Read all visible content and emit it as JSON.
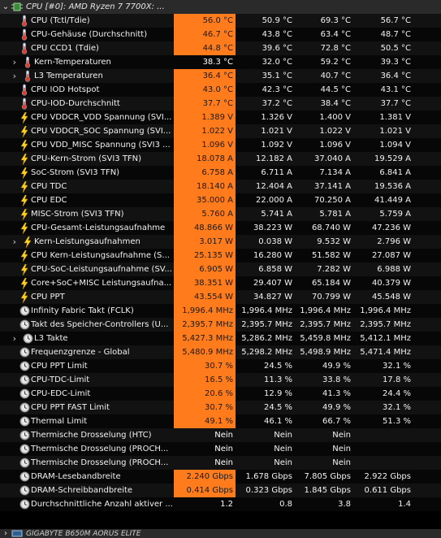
{
  "section": {
    "title": "CPU [#0]: AMD Ryzen 7 7700X: ..."
  },
  "footer_section": {
    "title": "GIGABYTE B650M AORUS ELITE"
  },
  "colors": {
    "highlight": "#ff7b1c",
    "row_odd": "#121212",
    "row_even": "#070707",
    "header": "#2a2a2a"
  },
  "rows": [
    {
      "label": "CPU (Tctl/Tdie)",
      "icon": "thermometer-icon",
      "chev": false,
      "indent": 0,
      "cur": "56.0 °C",
      "hl": true,
      "min": "50.9 °C",
      "max": "69.3 °C",
      "avg": "56.7 °C"
    },
    {
      "label": "CPU-Gehäuse (Durchschnitt)",
      "icon": "thermometer-icon",
      "chev": false,
      "indent": 0,
      "cur": "46.7 °C",
      "hl": true,
      "min": "43.8 °C",
      "max": "63.4 °C",
      "avg": "48.7 °C"
    },
    {
      "label": "CPU CCD1 (Tdie)",
      "icon": "thermometer-icon",
      "chev": false,
      "indent": 0,
      "cur": "44.8 °C",
      "hl": true,
      "min": "39.6 °C",
      "max": "72.8 °C",
      "avg": "50.5 °C"
    },
    {
      "label": "Kern-Temperaturen",
      "icon": "thermometer-icon",
      "chev": true,
      "indent": 1,
      "cur": "38.3 °C",
      "hl": false,
      "min": "32.0 °C",
      "max": "59.2 °C",
      "avg": "39.3 °C"
    },
    {
      "label": "L3 Temperaturen",
      "icon": "thermometer-icon",
      "chev": true,
      "indent": 1,
      "cur": "36.4 °C",
      "hl": true,
      "min": "35.1 °C",
      "max": "40.7 °C",
      "avg": "36.4 °C"
    },
    {
      "label": "CPU IOD Hotspot",
      "icon": "thermometer-icon",
      "chev": false,
      "indent": 0,
      "cur": "43.0 °C",
      "hl": true,
      "min": "42.3 °C",
      "max": "44.5 °C",
      "avg": "43.1 °C"
    },
    {
      "label": "CPU-IOD-Durchschnitt",
      "icon": "thermometer-icon",
      "chev": false,
      "indent": 0,
      "cur": "37.7 °C",
      "hl": true,
      "min": "37.2 °C",
      "max": "38.4 °C",
      "avg": "37.7 °C"
    },
    {
      "label": "CPU VDDCR_VDD Spannung (SVI...",
      "icon": "lightning-icon",
      "chev": false,
      "indent": 0,
      "cur": "1.389 V",
      "hl": true,
      "min": "1.326 V",
      "max": "1.400 V",
      "avg": "1.381 V"
    },
    {
      "label": "CPU VDDCR_SOC Spannung (SVI...",
      "icon": "lightning-icon",
      "chev": false,
      "indent": 0,
      "cur": "1.022 V",
      "hl": true,
      "min": "1.021 V",
      "max": "1.022 V",
      "avg": "1.021 V"
    },
    {
      "label": "CPU VDD_MISC Spannung (SVI3 ...",
      "icon": "lightning-icon",
      "chev": false,
      "indent": 0,
      "cur": "1.096 V",
      "hl": true,
      "min": "1.092 V",
      "max": "1.096 V",
      "avg": "1.094 V"
    },
    {
      "label": "CPU-Kern-Strom (SVI3 TFN)",
      "icon": "lightning-icon",
      "chev": false,
      "indent": 0,
      "cur": "18.078 A",
      "hl": true,
      "min": "12.182 A",
      "max": "37.040 A",
      "avg": "19.529 A"
    },
    {
      "label": "SoC-Strom (SVI3 TFN)",
      "icon": "lightning-icon",
      "chev": false,
      "indent": 0,
      "cur": "6.758 A",
      "hl": true,
      "min": "6.711 A",
      "max": "7.134 A",
      "avg": "6.841 A"
    },
    {
      "label": "CPU TDC",
      "icon": "lightning-icon",
      "chev": false,
      "indent": 0,
      "cur": "18.140 A",
      "hl": true,
      "min": "12.404 A",
      "max": "37.141 A",
      "avg": "19.536 A"
    },
    {
      "label": "CPU EDC",
      "icon": "lightning-icon",
      "chev": false,
      "indent": 0,
      "cur": "35.000 A",
      "hl": true,
      "min": "22.000 A",
      "max": "70.250 A",
      "avg": "41.449 A"
    },
    {
      "label": "MISC-Strom (SVI3 TFN)",
      "icon": "lightning-icon",
      "chev": false,
      "indent": 0,
      "cur": "5.760 A",
      "hl": true,
      "min": "5.741 A",
      "max": "5.781 A",
      "avg": "5.759 A"
    },
    {
      "label": "CPU-Gesamt-Leistungsaufnahme",
      "icon": "lightning-icon",
      "chev": false,
      "indent": 0,
      "cur": "48.866 W",
      "hl": true,
      "min": "38.223 W",
      "max": "68.740 W",
      "avg": "47.236 W"
    },
    {
      "label": "Kern-Leistungsaufnahmen",
      "icon": "lightning-icon",
      "chev": true,
      "indent": 1,
      "cur": "3.017 W",
      "hl": true,
      "min": "0.038 W",
      "max": "9.532 W",
      "avg": "2.796 W"
    },
    {
      "label": "CPU Kern-Leistungsaufnahme (S...",
      "icon": "lightning-icon",
      "chev": false,
      "indent": 0,
      "cur": "25.135 W",
      "hl": true,
      "min": "16.280 W",
      "max": "51.582 W",
      "avg": "27.087 W"
    },
    {
      "label": "CPU-SoC-Leistungsaufnahme (SV...",
      "icon": "lightning-icon",
      "chev": false,
      "indent": 0,
      "cur": "6.905 W",
      "hl": true,
      "min": "6.858 W",
      "max": "7.282 W",
      "avg": "6.988 W"
    },
    {
      "label": "Core+SoC+MISC Leistungsaufna...",
      "icon": "lightning-icon",
      "chev": false,
      "indent": 0,
      "cur": "38.351 W",
      "hl": true,
      "min": "29.407 W",
      "max": "65.184 W",
      "avg": "40.379 W"
    },
    {
      "label": "CPU PPT",
      "icon": "lightning-icon",
      "chev": false,
      "indent": 0,
      "cur": "43.554 W",
      "hl": true,
      "min": "34.827 W",
      "max": "70.799 W",
      "avg": "45.548 W"
    },
    {
      "label": "Infinity Fabric Takt (FCLK)",
      "icon": "clock-icon",
      "chev": false,
      "indent": 0,
      "cur": "1,996.4 MHz",
      "hl": true,
      "min": "1,996.4 MHz",
      "max": "1,996.4 MHz",
      "avg": "1,996.4 MHz"
    },
    {
      "label": "Takt des Speicher-Controllers (U...",
      "icon": "clock-icon",
      "chev": false,
      "indent": 0,
      "cur": "2,395.7 MHz",
      "hl": true,
      "min": "2,395.7 MHz",
      "max": "2,395.7 MHz",
      "avg": "2,395.7 MHz"
    },
    {
      "label": "L3 Takte",
      "icon": "clock-icon",
      "chev": true,
      "indent": 1,
      "cur": "5,427.3 MHz",
      "hl": true,
      "min": "5,286.2 MHz",
      "max": "5,459.8 MHz",
      "avg": "5,412.1 MHz"
    },
    {
      "label": "Frequenzgrenze - Global",
      "icon": "clock-icon",
      "chev": false,
      "indent": 0,
      "cur": "5,480.9 MHz",
      "hl": true,
      "min": "5,298.2 MHz",
      "max": "5,498.9 MHz",
      "avg": "5,471.4 MHz"
    },
    {
      "label": "CPU PPT Limit",
      "icon": "clock-icon",
      "chev": false,
      "indent": 0,
      "cur": "30.7 %",
      "hl": true,
      "min": "24.5 %",
      "max": "49.9 %",
      "avg": "32.1 %"
    },
    {
      "label": "CPU-TDC-Limit",
      "icon": "clock-icon",
      "chev": false,
      "indent": 0,
      "cur": "16.5 %",
      "hl": true,
      "min": "11.3 %",
      "max": "33.8 %",
      "avg": "17.8 %"
    },
    {
      "label": "CPU-EDC-Limit",
      "icon": "clock-icon",
      "chev": false,
      "indent": 0,
      "cur": "20.6 %",
      "hl": true,
      "min": "12.9 %",
      "max": "41.3 %",
      "avg": "24.4 %"
    },
    {
      "label": "CPU PPT FAST Limit",
      "icon": "clock-icon",
      "chev": false,
      "indent": 0,
      "cur": "30.7 %",
      "hl": true,
      "min": "24.5 %",
      "max": "49.9 %",
      "avg": "32.1 %"
    },
    {
      "label": "Thermal Limit",
      "icon": "clock-icon",
      "chev": false,
      "indent": 0,
      "cur": "49.1 %",
      "hl": true,
      "min": "46.1 %",
      "max": "66.7 %",
      "avg": "51.3 %"
    },
    {
      "label": "Thermische Drosselung (HTC)",
      "icon": "clock-icon",
      "chev": false,
      "indent": 0,
      "cur": "Nein",
      "hl": false,
      "min": "Nein",
      "max": "Nein",
      "avg": ""
    },
    {
      "label": "Thermische Drosselung (PROCH...",
      "icon": "clock-icon",
      "chev": false,
      "indent": 0,
      "cur": "Nein",
      "hl": false,
      "min": "Nein",
      "max": "Nein",
      "avg": ""
    },
    {
      "label": "Thermische Drosselung (PROCH...",
      "icon": "clock-icon",
      "chev": false,
      "indent": 0,
      "cur": "Nein",
      "hl": false,
      "min": "Nein",
      "max": "Nein",
      "avg": ""
    },
    {
      "label": "DRAM-Lesebandbreite",
      "icon": "clock-icon",
      "chev": false,
      "indent": 0,
      "cur": "2.240 Gbps",
      "hl": true,
      "min": "1.678 Gbps",
      "max": "7.805 Gbps",
      "avg": "2.922 Gbps"
    },
    {
      "label": "DRAM-Schreibbandbreite",
      "icon": "clock-icon",
      "chev": false,
      "indent": 0,
      "cur": "0.414 Gbps",
      "hl": true,
      "min": "0.323 Gbps",
      "max": "1.845 Gbps",
      "avg": "0.611 Gbps"
    },
    {
      "label": "Durchschnittliche Anzahl aktiver ...",
      "icon": "clock-icon",
      "chev": false,
      "indent": 0,
      "cur": "1.2",
      "hl": false,
      "min": "0.8",
      "max": "3.8",
      "avg": "1.4"
    }
  ]
}
